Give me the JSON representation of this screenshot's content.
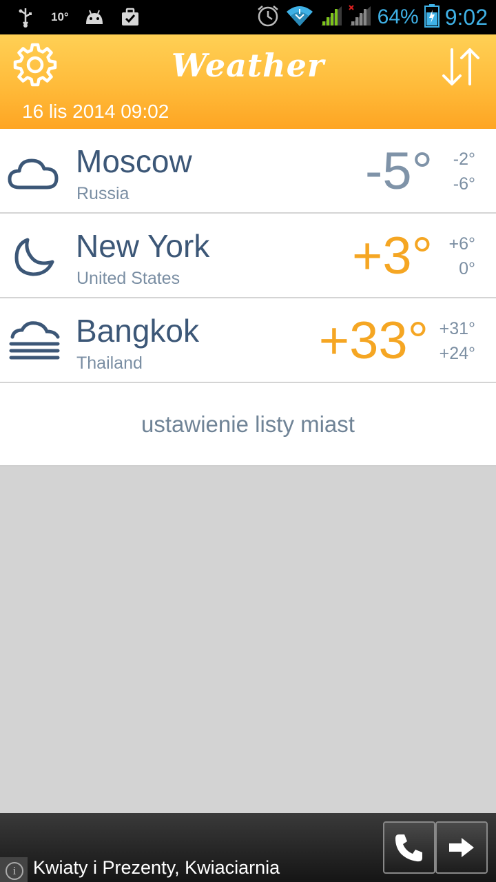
{
  "status_bar": {
    "temp_indicator": "10°",
    "battery_percent": "64%",
    "time": "9:02",
    "icons": [
      "usb-icon",
      "android-icon",
      "briefcase-check-icon",
      "alarm-icon",
      "wifi-icon",
      "signal-icon",
      "signal-no-data-icon",
      "battery-charging-icon"
    ],
    "accent_color": "#3fb1e6"
  },
  "header": {
    "title": "Weather",
    "date": "16 lis 2014 09:02",
    "icons": [
      "gear-icon",
      "sort-icon"
    ],
    "gradient_top": "#ffd055",
    "gradient_bottom": "#fea523"
  },
  "cities": [
    {
      "name": "Moscow",
      "country": "Russia",
      "temp": "-5°",
      "high": "-2°",
      "low": "-6°",
      "icon": "cloud-icon",
      "temp_color": "#7f93a8"
    },
    {
      "name": "New York",
      "country": "United States",
      "temp": "+3°",
      "high": "+6°",
      "low": "0°",
      "icon": "moon-icon",
      "temp_color": "#f5a623"
    },
    {
      "name": "Bangkok",
      "country": "Thailand",
      "temp": "+33°",
      "high": "+31°",
      "low": "+24°",
      "icon": "fog-icon",
      "temp_color": "#f5a623"
    }
  ],
  "manage_label": "ustawienie listy miast",
  "ad": {
    "text": "Kwiaty i Prezenty, Kwiaciarnia",
    "info_glyph": "i",
    "icons": [
      "info-icon",
      "phone-icon",
      "arrow-right-icon"
    ]
  }
}
